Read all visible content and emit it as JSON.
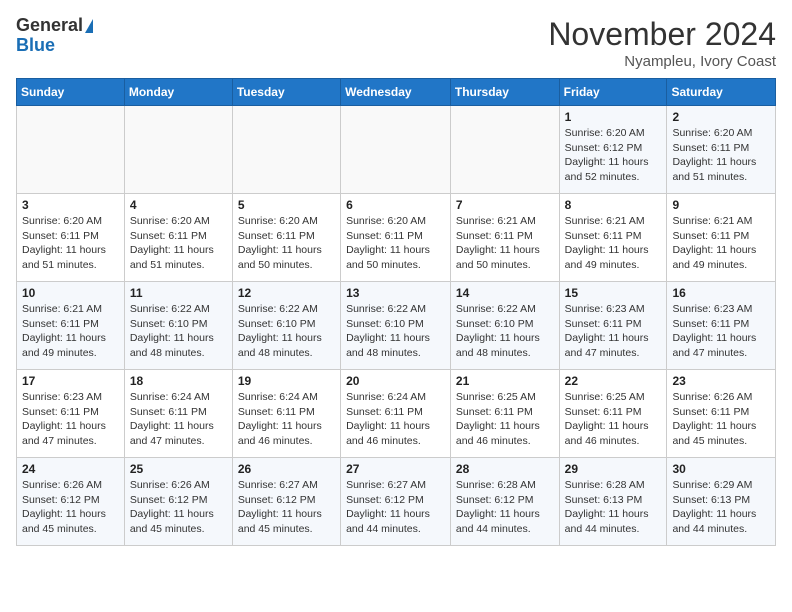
{
  "header": {
    "logo_general": "General",
    "logo_blue": "Blue",
    "month": "November 2024",
    "location": "Nyampleu, Ivory Coast"
  },
  "days_of_week": [
    "Sunday",
    "Monday",
    "Tuesday",
    "Wednesday",
    "Thursday",
    "Friday",
    "Saturday"
  ],
  "weeks": [
    [
      {
        "day": "",
        "info": ""
      },
      {
        "day": "",
        "info": ""
      },
      {
        "day": "",
        "info": ""
      },
      {
        "day": "",
        "info": ""
      },
      {
        "day": "",
        "info": ""
      },
      {
        "day": "1",
        "info": "Sunrise: 6:20 AM\nSunset: 6:12 PM\nDaylight: 11 hours\nand 52 minutes."
      },
      {
        "day": "2",
        "info": "Sunrise: 6:20 AM\nSunset: 6:11 PM\nDaylight: 11 hours\nand 51 minutes."
      }
    ],
    [
      {
        "day": "3",
        "info": "Sunrise: 6:20 AM\nSunset: 6:11 PM\nDaylight: 11 hours\nand 51 minutes."
      },
      {
        "day": "4",
        "info": "Sunrise: 6:20 AM\nSunset: 6:11 PM\nDaylight: 11 hours\nand 51 minutes."
      },
      {
        "day": "5",
        "info": "Sunrise: 6:20 AM\nSunset: 6:11 PM\nDaylight: 11 hours\nand 50 minutes."
      },
      {
        "day": "6",
        "info": "Sunrise: 6:20 AM\nSunset: 6:11 PM\nDaylight: 11 hours\nand 50 minutes."
      },
      {
        "day": "7",
        "info": "Sunrise: 6:21 AM\nSunset: 6:11 PM\nDaylight: 11 hours\nand 50 minutes."
      },
      {
        "day": "8",
        "info": "Sunrise: 6:21 AM\nSunset: 6:11 PM\nDaylight: 11 hours\nand 49 minutes."
      },
      {
        "day": "9",
        "info": "Sunrise: 6:21 AM\nSunset: 6:11 PM\nDaylight: 11 hours\nand 49 minutes."
      }
    ],
    [
      {
        "day": "10",
        "info": "Sunrise: 6:21 AM\nSunset: 6:11 PM\nDaylight: 11 hours\nand 49 minutes."
      },
      {
        "day": "11",
        "info": "Sunrise: 6:22 AM\nSunset: 6:10 PM\nDaylight: 11 hours\nand 48 minutes."
      },
      {
        "day": "12",
        "info": "Sunrise: 6:22 AM\nSunset: 6:10 PM\nDaylight: 11 hours\nand 48 minutes."
      },
      {
        "day": "13",
        "info": "Sunrise: 6:22 AM\nSunset: 6:10 PM\nDaylight: 11 hours\nand 48 minutes."
      },
      {
        "day": "14",
        "info": "Sunrise: 6:22 AM\nSunset: 6:10 PM\nDaylight: 11 hours\nand 48 minutes."
      },
      {
        "day": "15",
        "info": "Sunrise: 6:23 AM\nSunset: 6:11 PM\nDaylight: 11 hours\nand 47 minutes."
      },
      {
        "day": "16",
        "info": "Sunrise: 6:23 AM\nSunset: 6:11 PM\nDaylight: 11 hours\nand 47 minutes."
      }
    ],
    [
      {
        "day": "17",
        "info": "Sunrise: 6:23 AM\nSunset: 6:11 PM\nDaylight: 11 hours\nand 47 minutes."
      },
      {
        "day": "18",
        "info": "Sunrise: 6:24 AM\nSunset: 6:11 PM\nDaylight: 11 hours\nand 47 minutes."
      },
      {
        "day": "19",
        "info": "Sunrise: 6:24 AM\nSunset: 6:11 PM\nDaylight: 11 hours\nand 46 minutes."
      },
      {
        "day": "20",
        "info": "Sunrise: 6:24 AM\nSunset: 6:11 PM\nDaylight: 11 hours\nand 46 minutes."
      },
      {
        "day": "21",
        "info": "Sunrise: 6:25 AM\nSunset: 6:11 PM\nDaylight: 11 hours\nand 46 minutes."
      },
      {
        "day": "22",
        "info": "Sunrise: 6:25 AM\nSunset: 6:11 PM\nDaylight: 11 hours\nand 46 minutes."
      },
      {
        "day": "23",
        "info": "Sunrise: 6:26 AM\nSunset: 6:11 PM\nDaylight: 11 hours\nand 45 minutes."
      }
    ],
    [
      {
        "day": "24",
        "info": "Sunrise: 6:26 AM\nSunset: 6:12 PM\nDaylight: 11 hours\nand 45 minutes."
      },
      {
        "day": "25",
        "info": "Sunrise: 6:26 AM\nSunset: 6:12 PM\nDaylight: 11 hours\nand 45 minutes."
      },
      {
        "day": "26",
        "info": "Sunrise: 6:27 AM\nSunset: 6:12 PM\nDaylight: 11 hours\nand 45 minutes."
      },
      {
        "day": "27",
        "info": "Sunrise: 6:27 AM\nSunset: 6:12 PM\nDaylight: 11 hours\nand 44 minutes."
      },
      {
        "day": "28",
        "info": "Sunrise: 6:28 AM\nSunset: 6:12 PM\nDaylight: 11 hours\nand 44 minutes."
      },
      {
        "day": "29",
        "info": "Sunrise: 6:28 AM\nSunset: 6:13 PM\nDaylight: 11 hours\nand 44 minutes."
      },
      {
        "day": "30",
        "info": "Sunrise: 6:29 AM\nSunset: 6:13 PM\nDaylight: 11 hours\nand 44 minutes."
      }
    ]
  ]
}
